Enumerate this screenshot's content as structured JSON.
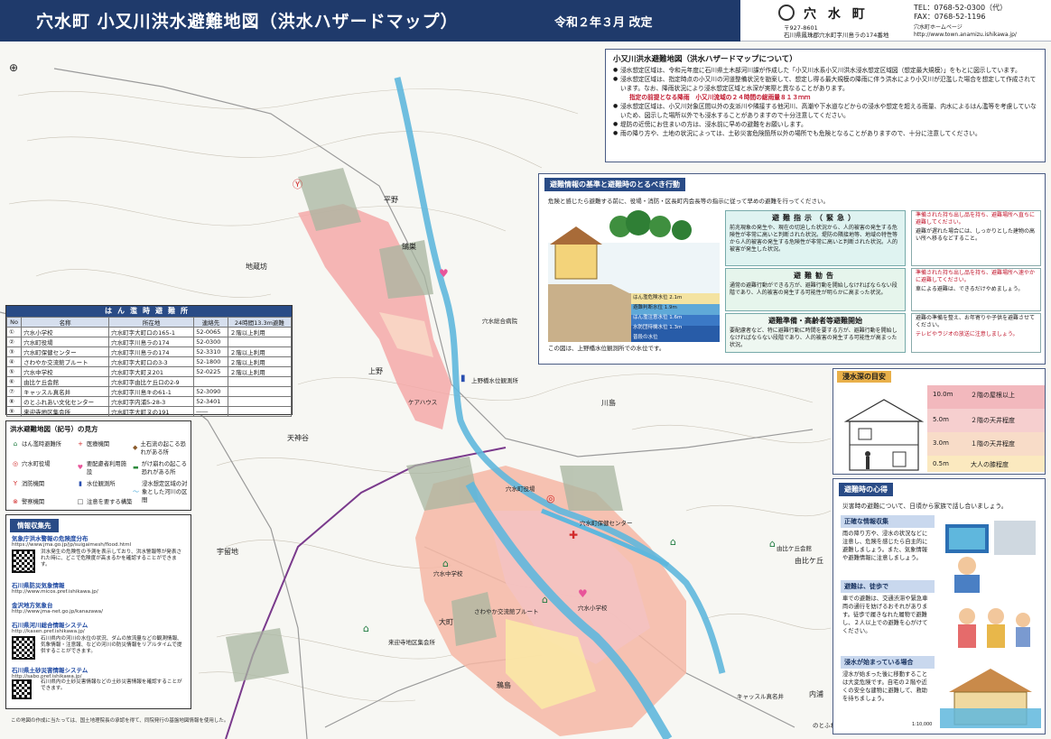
{
  "header": {
    "title": "穴水町 小又川洪水避難地図（洪水ハザードマップ）",
    "revision": "令和２年３月 改定"
  },
  "town": {
    "name": "穴 水 町",
    "tel": "TEL：0768-52-0300（代）",
    "fax": "FAX：0768-52-1196",
    "postal": "〒927-8601",
    "address": "石川県鳳珠郡穴水町字川島ラの174番地",
    "hp_label": "穴水町ホームページ",
    "hp_url": "http://www.town.anamizu.ishikawa.jp/"
  },
  "about": {
    "title": "小又川洪水避難地図（洪水ハザードマップについて）",
    "items": [
      "浸水想定区域は、令和元年度に石川県土木部河川課が作成した「小又川水系小又川洪水浸水想定区域図（想定最大規模）」をもとに図示しています。",
      "浸水想定区域は、指定時点の小又川の河道整備状況を勘案して、想定し得る最大規模の降雨に伴う洪水により小又川が氾濫した場合を想定して作成されています。なお、降雨状況により浸水想定区域と水深が実際と異なることがあります。",
      "浸水想定区域は、小又川対象区間以外の支派川や隣接する他河川、高潮や下水道などからの浸水や想定を超える雨量、内水によるはん濫等を考慮していないため、図示した場所以外でも浸水することがありますので十分注意してください。",
      "堤防の近傍にお住まいの方は、浸水前に早めの避難をお願いします。",
      "雨の降り方や、土地の状況によっては、土砂災害危険箇所以外の場所でも危険となることがありますので、十分に注意してください。"
    ],
    "rainfall": "指定の前提となる降雨　小又川流域の２４時間の総雨量８１３ｍｍ"
  },
  "action": {
    "title": "避難情報の基準と避難時のとるべき行動",
    "intro": "危険と感じたら避難する前に、役場・消防・区長町内会長等の指示に従って早めの避難を行ってください。",
    "caption": "この図は、上野橋水位観測所での水位です。",
    "levels": [
      {
        "title": "避難指示（緊急）",
        "desc": "前兆現象の発生や、現在の切迫した状況から、人的被害の発生する危険性が非常に高いと判断された状況。堤防の隣接地等、地域の特性等から人的被害の発生する危険性が非常に高いと判断された状況。人的被害が発生した状況。"
      },
      {
        "title": "避難勧告",
        "desc": "通常の避難行動ができる方が、避難行動を開始しなければならない段階であり、人的被害の発生する可能性が明らかに高まった状況。"
      },
      {
        "title": "避難準備・高齢者等避難開始",
        "desc": "要配慮者など、特に避難行動に時間を要する方が、避難行動を開始しなければならない段階であり、人的被害の発生する可能性が高まった状況。"
      }
    ],
    "actions": [
      {
        "text": "準備された持ち出し品を持ち、避難場所へ直ちに避難してください。",
        "note": "避難が遅れた場合には、しっかりとした建物の高い所へ移るなどすること。"
      },
      {
        "text": "準備された持ち出し品を持ち、避難場所へ速やかに避難してください。",
        "note": "車による避難は、できるだけやめましょう。"
      },
      {
        "text": "避難の準備を整え、お年寄りや子供を避難させてください。",
        "note": "テレビやラジオの放送に注意しましょう。"
      }
    ],
    "gauge": [
      "はん濫危険水位 2.1m",
      "避難判断水位 1.9m",
      "はん濫注意水位 1.6m",
      "水防団待機水位 1.3m",
      "普段の水位"
    ]
  },
  "depth": {
    "title": "浸水深の目安",
    "bands": [
      {
        "depth": "10.0m",
        "label": "２階の屋根以上",
        "color": "#f2b8bd"
      },
      {
        "depth": "5.0m",
        "label": "２階の天井程度",
        "color": "#f6cfcf"
      },
      {
        "depth": "3.0m",
        "label": "１階の天井程度",
        "color": "#f8dcc8"
      },
      {
        "depth": "0.5m",
        "label": "大人の膝程度",
        "color": "#fbe9bf"
      }
    ]
  },
  "mind": {
    "title": "避難時の心得",
    "intro": "災害時の避難について、日頃から家族で話し合いましょう。",
    "items": [
      {
        "title": "正確な情報収集",
        "text": "雨の降り方や、浸水の状況などに注意し、危険を感じたら自主的に避難しましょう。また、気象情報や避難情報に注意しましょう。"
      },
      {
        "title": "避難は、徒歩で",
        "text": "車での避難は、交通渋滞や緊急車両の通行を妨げるおそれがあります。徒歩で履きなれた履物で避難し、２人以上での避難を心がけてください。"
      },
      {
        "title": "浸水が始まっている場合",
        "text": "浸水が始まった後に移動することは大変危険です。自宅の２階や近くの安全な建物に避難して、救助を待ちましょう。"
      }
    ]
  },
  "shelter": {
    "title": "はん濫時避難所",
    "headers": [
      "No",
      "名称",
      "所在地",
      "連絡先",
      "24時間13.3m避難"
    ],
    "rows": [
      [
        "①",
        "穴水小学校",
        "穴水町字大町ロの165-1",
        "52-0065",
        "２階以上利用"
      ],
      [
        "②",
        "穴水町役場",
        "穴水町字川島ラの174",
        "52-0300",
        ""
      ],
      [
        "③",
        "穴水町保健センター",
        "穴水町字川島ラの174",
        "52-3310",
        "２階以上利用"
      ],
      [
        "④",
        "さわやか交流館プルート",
        "穴水町字大町ロの3-3",
        "52-1800",
        "２階以上利用"
      ],
      [
        "⑤",
        "穴水中学校",
        "穴水町字大町ヌ201",
        "52-0225",
        "２階以上利用"
      ],
      [
        "⑥",
        "由比ケ丘会館",
        "穴水町字由比ケ丘ロの2-9",
        "",
        ""
      ],
      [
        "⑦",
        "キャッスル真名井",
        "穴水町字川島キの61-1",
        "52-3090",
        ""
      ],
      [
        "⑧",
        "のとふれあい文化センター",
        "穴水町字内浦5-28-3",
        "52-3401",
        ""
      ],
      [
        "⑨",
        "来迎寺地区集会所",
        "穴水町字大町ヌの191",
        "――",
        ""
      ]
    ]
  },
  "legend": {
    "title": "洪水避難地図（記号）の見方",
    "items": [
      {
        "icon": "shelter-icon",
        "glyph": "⌂",
        "label": "はん濫時避難所",
        "color": "#1c7a3e"
      },
      {
        "icon": "medical-icon",
        "glyph": "+",
        "label": "医療機関",
        "color": "#d22a2a"
      },
      {
        "icon": "landslide-icon",
        "glyph": "◆",
        "label": "土石流の起こる恐れがある所",
        "color": "#8a5a2b"
      },
      {
        "icon": "town-hall-icon",
        "glyph": "◎",
        "label": "穴水町役場",
        "color": "#d22a2a"
      },
      {
        "icon": "care-facility-icon",
        "glyph": "♥",
        "label": "要配慮者利用施設",
        "color": "#e8559a"
      },
      {
        "icon": "cliff-icon",
        "glyph": "▬",
        "label": "がけ崩れの起こる恐れがある所",
        "color": "#2c8a3c"
      },
      {
        "icon": "fire-station-icon",
        "glyph": "Y",
        "label": "消防機関",
        "color": "#d22a2a"
      },
      {
        "icon": "water-gauge-icon",
        "glyph": "▮",
        "label": "水位観測所",
        "color": "#2a4fb0"
      },
      {
        "icon": "river-icon",
        "glyph": "〜",
        "label": "浸水想定区域の対象とした河川の区間",
        "color": "#4aa9d8"
      },
      {
        "icon": "police-icon",
        "glyph": "⊗",
        "label": "警察機関",
        "color": "#d22a2a"
      },
      {
        "icon": "caution-building-icon",
        "glyph": "□",
        "label": "注意を要する構築",
        "color": "#333333"
      }
    ]
  },
  "info": {
    "title": "情報収集先",
    "entries": [
      {
        "name": "気象庁洪水警報の危険度分布",
        "url": "https://www.jma.go.jp/jp/suigaimesh/flood.html",
        "desc": "洪水発生の危険性の予測を表示しており、洪水警報等が発表された時に、どこで危険度が高まるかを確認することができます。"
      },
      {
        "name": "石川県防災気象情報",
        "url": "http://www.micos.pref.ishikawa.jp/",
        "desc": ""
      },
      {
        "name": "金沢地方気象台",
        "url": "http://www.jma-net.go.jp/kanazawa/",
        "desc": ""
      },
      {
        "name": "石川県河川総合情報システム",
        "url": "http://kasen.pref.ishikawa.jp/",
        "desc": "石川県内の河川の水位の状況、ダムの放流量などの観測情報、気象情報・注意報、などの河川の防災情報をリアルタイムで提供することができます。"
      },
      {
        "name": "石川県土砂災害情報システム",
        "url": "http://sabo.pref.ishikawa.jp/",
        "desc": "石川県内の土砂災害情報などの土砂災害情報を確認することができます。"
      }
    ]
  },
  "places": [
    {
      "text": "平野",
      "cls": ""
    },
    {
      "text": "鵠巣",
      "cls": ""
    },
    {
      "text": "上野",
      "cls": ""
    },
    {
      "text": "川島",
      "cls": ""
    },
    {
      "text": "大町",
      "cls": ""
    },
    {
      "text": "宇留地",
      "cls": ""
    },
    {
      "text": "由比ケ丘",
      "cls": ""
    },
    {
      "text": "鵜島",
      "cls": ""
    },
    {
      "text": "天神谷",
      "cls": ""
    },
    {
      "text": "地蔵坊",
      "cls": ""
    },
    {
      "text": "内浦",
      "cls": ""
    }
  ],
  "map_labels": [
    "穴水町保健センター",
    "穴水町役場",
    "穴水中学校",
    "穴水小学校",
    "さわやか交流館プルート",
    "来迎寺地区集会所",
    "由比ケ丘会館",
    "キャッスル真名井",
    "のとふれあい文化センター",
    "上野橋水位観測所",
    "穴水総合病院",
    "ケアハウス"
  ],
  "footnote": "この地図の作成に当たっては、国土地理院長の承認を得て、同院発行の基盤地図情報を使用した。",
  "scale": "1:10,000"
}
